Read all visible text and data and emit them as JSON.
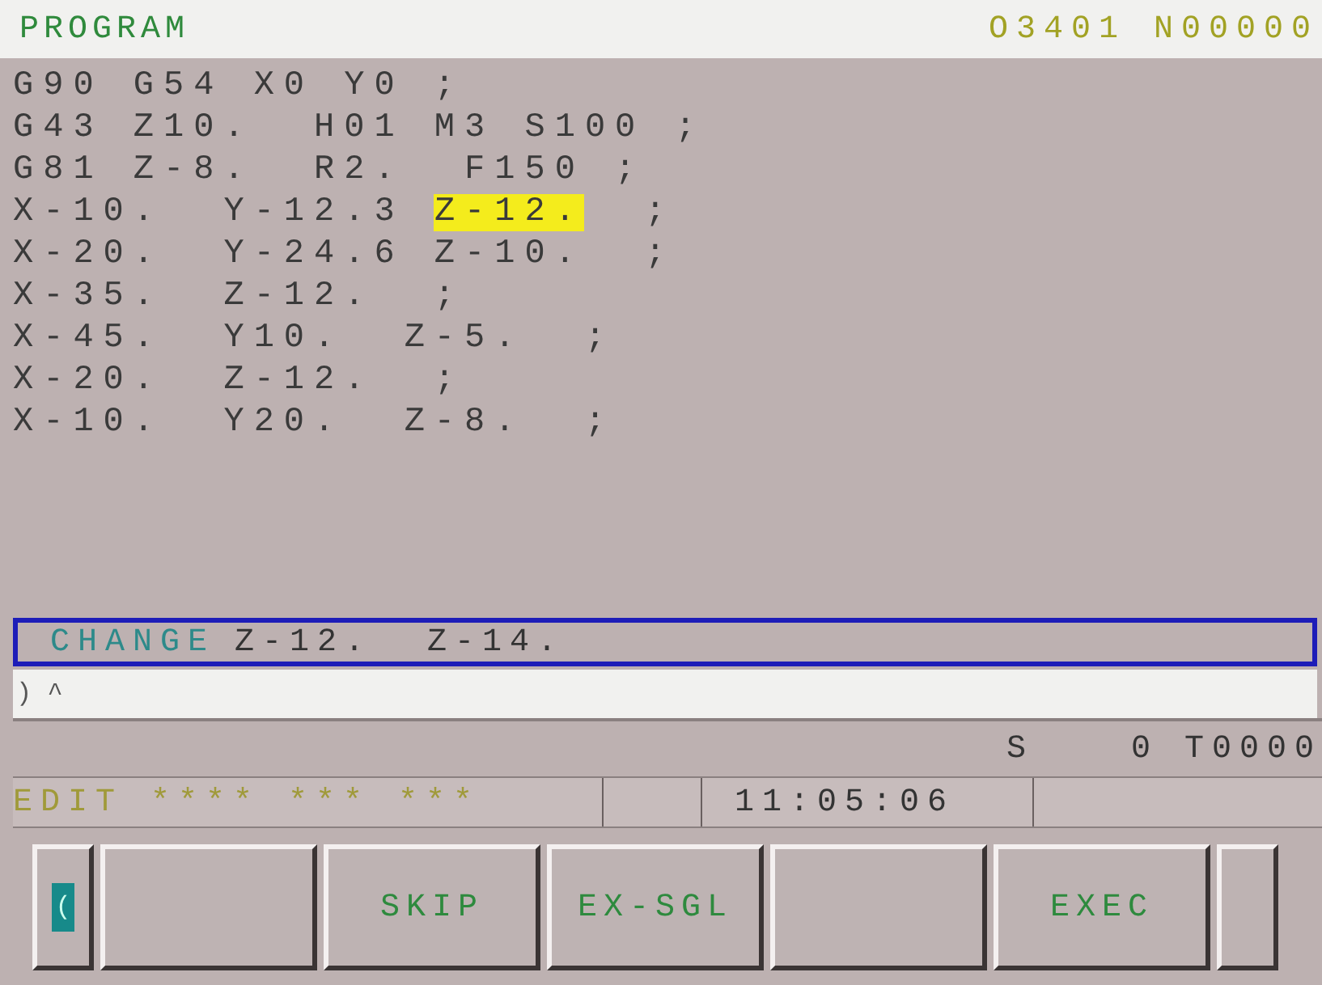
{
  "header": {
    "title": "PROGRAM",
    "program_number": "O3401 N00000"
  },
  "program_lines": [
    {
      "segments": [
        {
          "text": "G90 G54 X0 Y0 ;",
          "highlighted": false
        }
      ]
    },
    {
      "segments": [
        {
          "text": "G43 Z10.  H01 M3 S100 ;",
          "highlighted": false
        }
      ]
    },
    {
      "segments": [
        {
          "text": "G81 Z-8.  R2.  F150 ;",
          "highlighted": false
        }
      ]
    },
    {
      "segments": [
        {
          "text": "X-10.  Y-12.3 ",
          "highlighted": false
        },
        {
          "text": "Z-12.",
          "highlighted": true
        },
        {
          "text": "  ;",
          "highlighted": false
        }
      ]
    },
    {
      "segments": [
        {
          "text": "X-20.  Y-24.6 Z-10.  ;",
          "highlighted": false
        }
      ]
    },
    {
      "segments": [
        {
          "text": "X-35.  Z-12.  ;",
          "highlighted": false
        }
      ]
    },
    {
      "segments": [
        {
          "text": "X-45.  Y10.  Z-5.  ;",
          "highlighted": false
        }
      ]
    },
    {
      "segments": [
        {
          "text": "X-20.  Z-12.  ;",
          "highlighted": false
        }
      ]
    },
    {
      "segments": [
        {
          "text": "X-10.  Y20.  Z-8.  ;",
          "highlighted": false
        }
      ]
    }
  ],
  "change_box": {
    "label": "CHANGE",
    "value": "Z-12.  Z-14."
  },
  "input_line": {
    "value": ") ^"
  },
  "spindle_line": {
    "s_label": "S",
    "s_value": "0",
    "tool": "T0000"
  },
  "status_bar": {
    "mode": "EDIT **** *** ***",
    "time": "11:05:06"
  },
  "softkeys": [
    {
      "kind": "left",
      "label": "("
    },
    {
      "kind": "key"
    },
    {
      "kind": "key",
      "label": "SKIP"
    },
    {
      "kind": "key",
      "label": "EX-SGL"
    },
    {
      "kind": "key"
    },
    {
      "kind": "key",
      "label": "EXEC"
    },
    {
      "kind": "right"
    }
  ]
}
